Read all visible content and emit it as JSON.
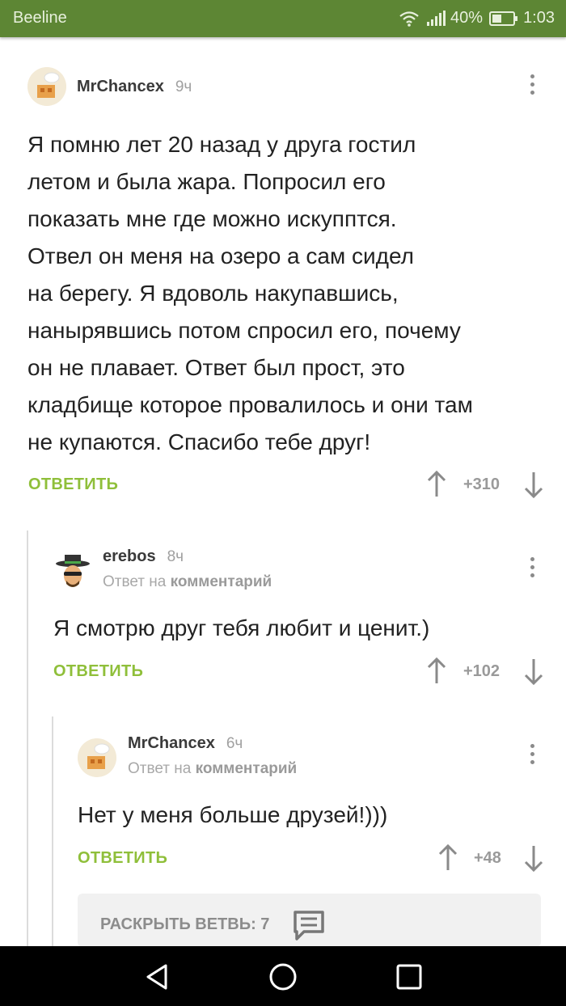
{
  "status": {
    "carrier": "Beeline",
    "battery": "40%",
    "time": "1:03"
  },
  "comments": [
    {
      "author": "MrChancex",
      "time": "9ч",
      "lines": [
        "Я помню лет 20 назад у друга гостил",
        "летом и была жара. Попросил его",
        "показать мне где можно искупптся.",
        "Отвел он меня на озеро а сам сидел",
        "на берегу. Я вдоволь накупавшись,",
        "нанырявшись потом спросил его, почему",
        "он не плавает. Ответ был прост, это",
        "кладбище которое провалилось и они там",
        "не купаются. Спасибо тебе друг!"
      ],
      "reply_label": "ОТВЕТИТЬ",
      "rating": "+310"
    },
    {
      "author": "erebos",
      "time": "8ч",
      "reply_to_prefix": "Ответ на",
      "reply_to_target": "комментарий",
      "text": "Я смотрю друг тебя любит и ценит.)",
      "reply_label": "ОТВЕТИТЬ",
      "rating": "+102"
    },
    {
      "author": "MrChancex",
      "time": "6ч",
      "reply_to_prefix": "Ответ на",
      "reply_to_target": "комментарий",
      "text": "Нет у меня больше друзей!)))",
      "reply_label": "ОТВЕТИТЬ",
      "rating": "+48"
    }
  ],
  "expand_branch": {
    "label": "РАСКРЫТЬ ВЕТВЬ: 7"
  },
  "icons": {
    "wifi": "wifi-icon",
    "signal": "signal-icon",
    "battery": "battery-icon",
    "more": "kebab-menu-icon",
    "up": "arrow-up-icon",
    "down": "arrow-down-icon",
    "thread": "comments-icon",
    "back": "nav-back-icon",
    "home": "nav-home-icon",
    "recent": "nav-recent-icon"
  },
  "colors": {
    "statusbar": "#5d8634",
    "reply": "#8fbf3a",
    "navbar": "#000000"
  }
}
